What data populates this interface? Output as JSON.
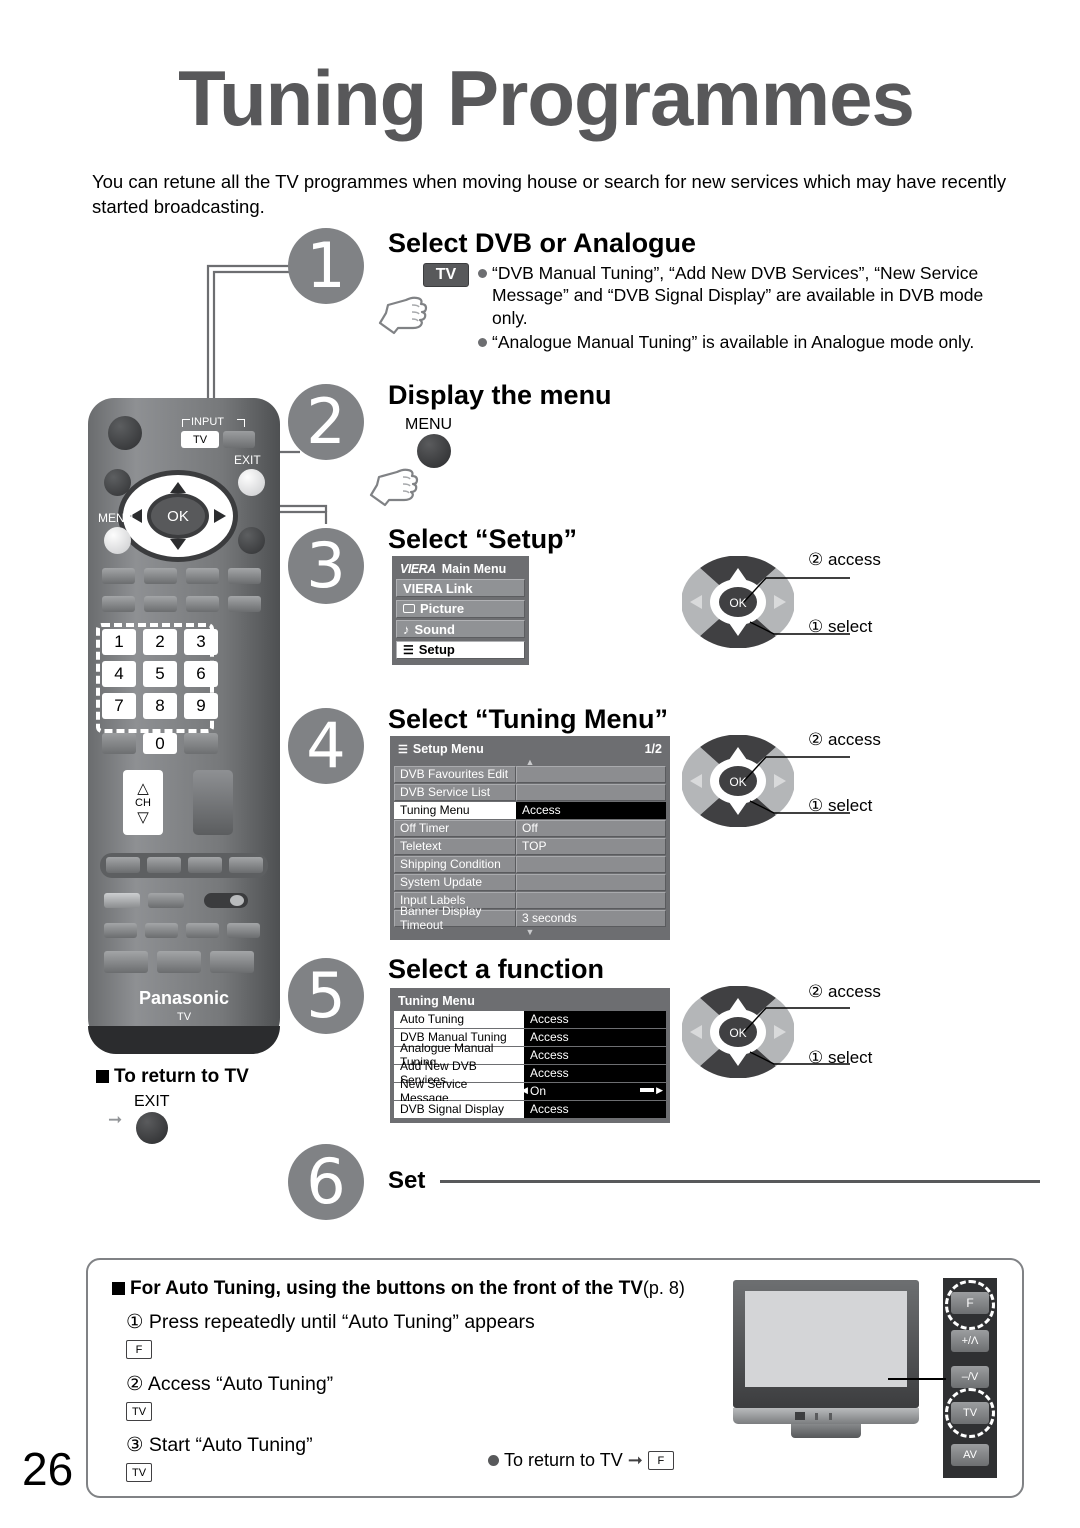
{
  "page": {
    "title": "Tuning Programmes",
    "intro": "You can retune all the TV programmes when moving house or search for new services which may have recently started broadcasting.",
    "page_number": "26"
  },
  "steps": [
    {
      "number": "1",
      "heading": "Select DVB or Analogue",
      "key": "TV",
      "bullets": [
        "“DVB Manual Tuning”, “Add New DVB Services”, “New Service Message” and “DVB Signal Display” are available in DVB mode only.",
        "“Analogue Manual Tuning” is available in Analogue mode only."
      ]
    },
    {
      "number": "2",
      "heading": "Display the menu",
      "key": "MENU"
    },
    {
      "number": "3",
      "heading": "Select “Setup”"
    },
    {
      "number": "4",
      "heading": "Select “Tuning Menu”"
    },
    {
      "number": "5",
      "heading": "Select a function"
    },
    {
      "number": "6",
      "heading": "Set"
    }
  ],
  "main_menu": {
    "title": "Main Menu",
    "brand": "VIERA",
    "items": [
      {
        "label": "VIERA Link",
        "icon": "none",
        "selected": false
      },
      {
        "label": "Picture",
        "icon": "picture-icon",
        "selected": false
      },
      {
        "label": "Sound",
        "icon": "note-icon",
        "selected": false
      },
      {
        "label": "Setup",
        "icon": "list-icon",
        "selected": true
      }
    ]
  },
  "setup_menu": {
    "title": "Setup Menu",
    "page_indicator": "1/2",
    "rows": [
      {
        "label": "DVB Favourites Edit",
        "value": "",
        "selected": false
      },
      {
        "label": "DVB Service List",
        "value": "",
        "selected": false
      },
      {
        "label": "Tuning Menu",
        "value": "Access",
        "selected": true
      },
      {
        "label": "Off Timer",
        "value": "Off",
        "selected": false
      },
      {
        "label": "Teletext",
        "value": "TOP",
        "selected": false
      },
      {
        "label": "Shipping Condition",
        "value": "",
        "selected": false
      },
      {
        "label": "System Update",
        "value": "",
        "selected": false
      },
      {
        "label": "Input Labels",
        "value": "",
        "selected": false
      },
      {
        "label": "Banner Display Timeout",
        "value": "3 seconds",
        "selected": false
      }
    ]
  },
  "tuning_menu": {
    "title": "Tuning Menu",
    "rows": [
      {
        "label": "Auto Tuning",
        "value": "Access",
        "selected": true
      },
      {
        "label": "DVB Manual Tuning",
        "value": "Access",
        "selected": true
      },
      {
        "label": "Analogue Manual Tuning",
        "value": "Access",
        "selected": true
      },
      {
        "label": "Add New DVB Services",
        "value": "Access",
        "selected": true
      },
      {
        "label": "New Service Message",
        "value": "On",
        "selected": true
      },
      {
        "label": "DVB Signal Display",
        "value": "Access",
        "selected": true
      }
    ]
  },
  "dpad_notes": {
    "access": "② access",
    "select": "① select",
    "ok_label": "OK"
  },
  "remote": {
    "brand": "Panasonic",
    "sub_brand": "TV",
    "labels": {
      "input": "INPUT",
      "tv": "TV",
      "exit": "EXIT",
      "menu": "MENU",
      "ok": "OK",
      "ch": "CH"
    },
    "numbers": [
      "1",
      "2",
      "3",
      "4",
      "5",
      "6",
      "7",
      "8",
      "9",
      "0"
    ]
  },
  "return_to_tv": {
    "heading": "To return to TV",
    "key": "EXIT"
  },
  "bottom_box": {
    "heading": "For Auto Tuning, using the buttons on the front of the TV",
    "heading_ref": "(p. 8)",
    "steps": [
      {
        "num": "①",
        "text": "Press repeatedly until “Auto Tuning” appears",
        "key": "F"
      },
      {
        "num": "②",
        "text": "Access “Auto Tuning”",
        "key": "TV"
      },
      {
        "num": "③",
        "text": "Start “Auto Tuning”",
        "key": "TV"
      }
    ],
    "return_note": "To return to TV",
    "return_key": "F",
    "tv_buttons": [
      "F",
      "+/Λ",
      "–/V",
      "TV",
      "AV"
    ]
  },
  "colors": {
    "title_grey": "#58585a",
    "bubble_grey": "#808285",
    "osd_grey": "#6d6e71",
    "osd_row": "#8c8d90",
    "selected_bg": "#000000"
  }
}
